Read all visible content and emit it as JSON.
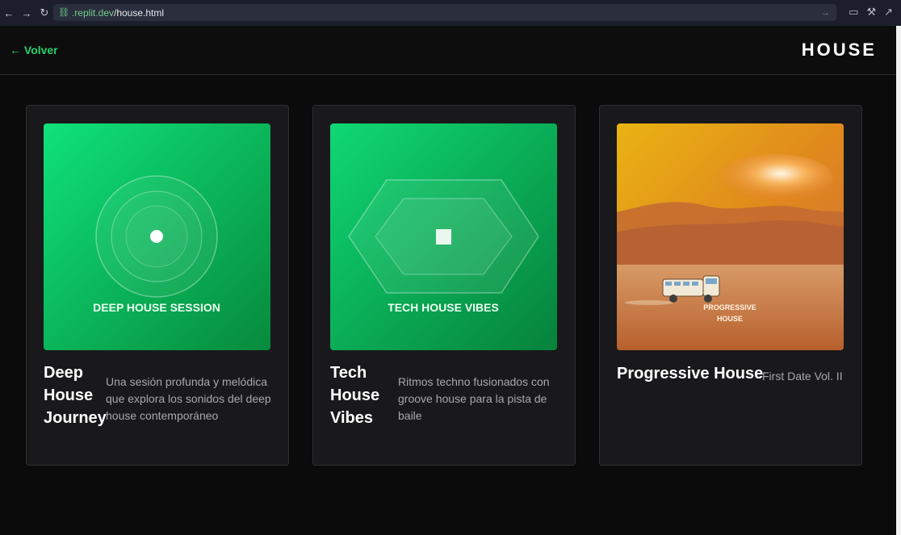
{
  "browser": {
    "url_host": ".replit.dev",
    "url_path": "/house.html"
  },
  "header": {
    "back_label": "← Volver",
    "title": "HOUSE"
  },
  "cards": [
    {
      "art_label": "DEEP HOUSE SESSION",
      "title": "Deep House Journey",
      "description": "Una sesión profunda y melódica que explora los sonidos del deep house contemporáneo"
    },
    {
      "art_label": "TECH HOUSE VIBES",
      "title": "Tech House Vibes",
      "description": "Ritmos techno fusionados con groove house para la pista de baile"
    },
    {
      "art_label_line1": "PROGRESSIVE",
      "art_label_line2": "HOUSE",
      "title": "Progressive House",
      "description": "First Date Vol. II"
    }
  ],
  "colors": {
    "accent": "#22d06a",
    "background": "#0b0b0c",
    "card": "#19191b"
  }
}
